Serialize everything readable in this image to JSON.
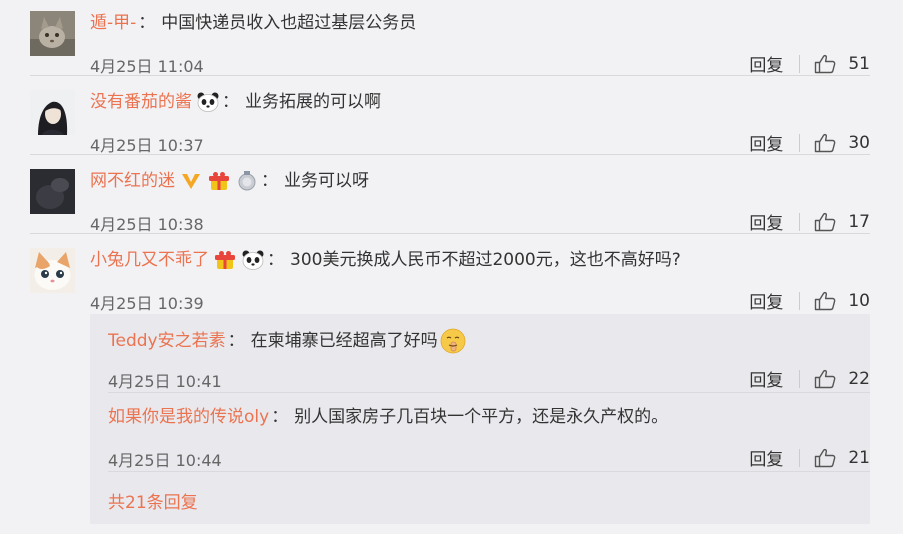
{
  "comments": [
    {
      "username": "遁-甲-",
      "text": "中国快递员收入也超过基层公务员",
      "time": "4月25日 11:04",
      "reply_label": "回复",
      "likes": "51",
      "avatar": "cat-avatar"
    },
    {
      "username": "没有番茄的酱",
      "text": "业务拓展的可以啊",
      "time": "4月25日 10:37",
      "reply_label": "回复",
      "likes": "30",
      "avatar": "girl-avatar",
      "badges": [
        "panda-icon"
      ]
    },
    {
      "username": "网不红的迷",
      "text": "业务可以呀",
      "time": "4月25日 10:38",
      "reply_label": "回复",
      "likes": "17",
      "avatar": "dark-avatar",
      "badges": [
        "v-badge-icon",
        "gift-badge-icon",
        "medal-icon"
      ]
    },
    {
      "username": "小兔几又不乖了",
      "text": "300美元换成人民币不超过2000元，这也不高好吗?",
      "time": "4月25日 10:39",
      "reply_label": "回复",
      "likes": "10",
      "avatar": "kitten-avatar",
      "badges": [
        "gift-badge-icon",
        "panda-icon"
      ]
    }
  ],
  "replies": [
    {
      "username": "Teddy安之若素",
      "text": "在柬埔寨已经超高了好吗",
      "time": "4月25日 10:41",
      "reply_label": "回复",
      "likes": "22",
      "emoji": "shush-emoji"
    },
    {
      "username": "如果你是我的传说oly",
      "text": "别人国家房子几百块一个平方，还是永久产权的。",
      "time": "4月25日 10:44",
      "reply_label": "回复",
      "likes": "21"
    }
  ],
  "more_replies_label": "共21条回复",
  "colors": {
    "accent": "#eb7350",
    "background": "#f2f2f5",
    "reply_box": "#e9e9ed"
  }
}
